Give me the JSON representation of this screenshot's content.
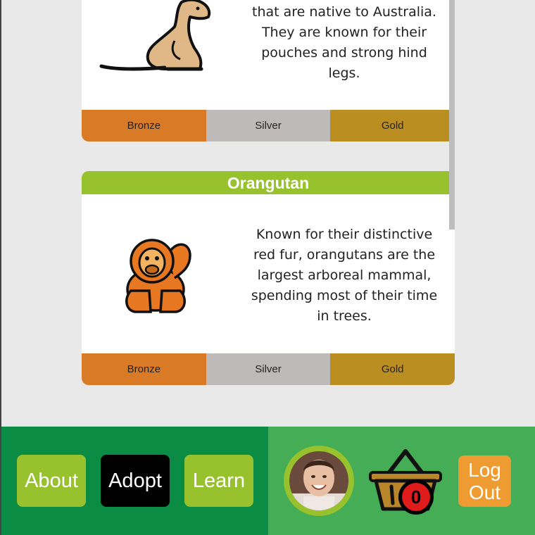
{
  "cards": [
    {
      "title": "",
      "description": "that are native to Australia. They are known for their pouches and strong hind legs.",
      "image_icon": "kangaroo-icon",
      "tiers": {
        "bronze": "Bronze",
        "silver": "Silver",
        "gold": "Gold"
      }
    },
    {
      "title": "Orangutan",
      "description": "Known for their distinctive red fur, orangutans are the largest arboreal mammal, spending most of their time in trees.",
      "image_icon": "orangutan-icon",
      "tiers": {
        "bronze": "Bronze",
        "silver": "Silver",
        "gold": "Gold"
      }
    }
  ],
  "nav": {
    "about": "About",
    "adopt": "Adopt",
    "learn": "Learn",
    "active": "Adopt"
  },
  "user": {
    "avatar_icon": "user-avatar",
    "basket_icon": "basket-icon",
    "basket_count": "0"
  },
  "logout": {
    "line1": "Log",
    "line2": "Out"
  },
  "colors": {
    "header_green": "#97c22e",
    "bronze": "#d97a27",
    "silver": "#bfbaba",
    "gold": "#bb8e22",
    "footer_dark": "#0a8c45",
    "footer_light": "#45ad55",
    "logout_orange": "#ee9c32",
    "badge_red": "#e01b1b"
  }
}
